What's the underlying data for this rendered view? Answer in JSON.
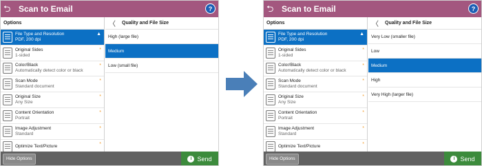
{
  "app_title": "Scan to Email",
  "help_glyph": "?",
  "back_glyph": "⮌",
  "options_header": "Options",
  "detail_title": "Quality and File Size",
  "options": [
    {
      "label": "File Type and Resolution",
      "value": "PDF, 200 dpi",
      "selected": true,
      "mark": "▲"
    },
    {
      "label": "Original Sides",
      "value": "1-sided",
      "selected": false,
      "mark": "*"
    },
    {
      "label": "Color/Black",
      "value": "Automatically detect color or black",
      "selected": false,
      "mark": "*"
    },
    {
      "label": "Scan Mode",
      "value": "Standard document",
      "selected": false,
      "mark": "*"
    },
    {
      "label": "Original Size",
      "value": "Any Size",
      "selected": false,
      "mark": "*"
    },
    {
      "label": "Content Orientation",
      "value": "Portrait",
      "selected": false,
      "mark": "*"
    },
    {
      "label": "Image Adjustment",
      "value": "Standard",
      "selected": false,
      "mark": "*"
    },
    {
      "label": "Optimize Text/Picture",
      "value": "",
      "selected": false,
      "mark": "*"
    }
  ],
  "before": {
    "quality_options": [
      "High (large file)",
      "Medium",
      "Low (small file)"
    ],
    "selected_index": 1
  },
  "after": {
    "quality_options": [
      "Very Low (smaller file)",
      "Low",
      "Medium",
      "High",
      "Very High (larger file)"
    ],
    "selected_index": 2
  },
  "footer": {
    "hide_options_label": "Hide Options",
    "send_label": "Send"
  },
  "colors": {
    "titlebar": "#a3577f",
    "selection": "#0c70c4",
    "send": "#3c8b3c",
    "footer": "#616161",
    "arrow": "#4a7fb8"
  }
}
